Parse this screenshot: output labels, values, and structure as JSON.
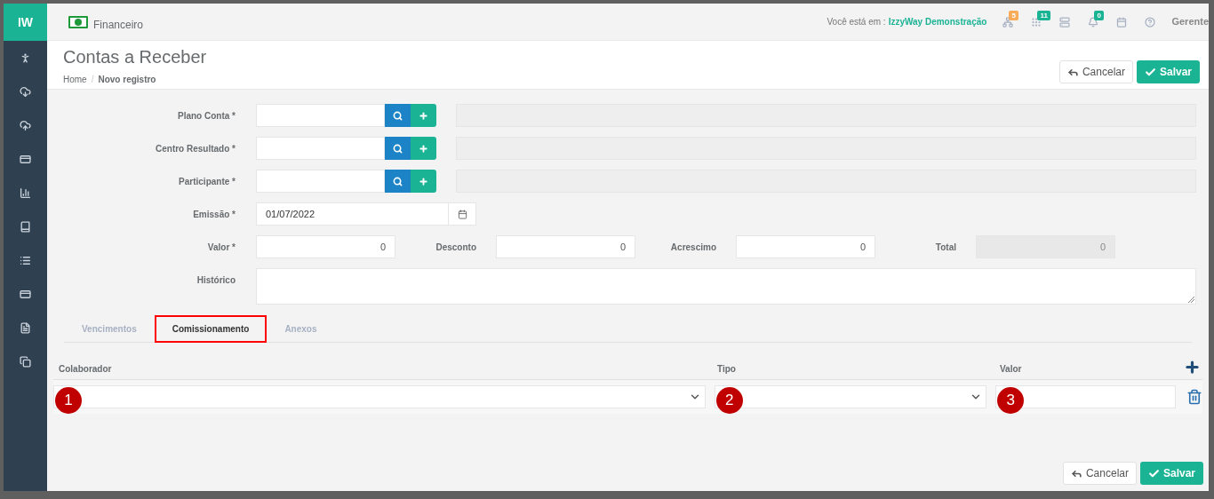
{
  "sidebar": {
    "logo": "IW",
    "items": [
      {
        "kind": "person"
      },
      {
        "kind": "download"
      },
      {
        "kind": "upload"
      },
      {
        "kind": "card"
      },
      {
        "kind": "chart"
      },
      {
        "kind": "book"
      },
      {
        "kind": "list"
      },
      {
        "kind": "card"
      },
      {
        "kind": "file"
      },
      {
        "kind": "copy"
      }
    ]
  },
  "header": {
    "module": "Financeiro",
    "location_label": "Você está em :",
    "location": "IzzyWay Demonstração",
    "icons": [
      {
        "kind": "sitemap",
        "badge": "5",
        "color": "#f8ac59"
      },
      {
        "kind": "grid",
        "badge": "11",
        "color": "#1ab394"
      },
      {
        "kind": "server"
      },
      {
        "kind": "bell",
        "badge": "0",
        "color": "#1ab394"
      },
      {
        "kind": "calendar"
      },
      {
        "kind": "help"
      }
    ],
    "user": "Gerente"
  },
  "page": {
    "title": "Contas a Receber",
    "breadcrumb": [
      "Home",
      "Novo registro"
    ],
    "separator": "/"
  },
  "top_actions": [
    {
      "kind": "cancel",
      "label": "Cancelar"
    },
    {
      "kind": "save",
      "label": "Salvar"
    }
  ],
  "form": [
    {
      "kind": "lookup",
      "label": "Plano Conta *"
    },
    {
      "kind": "lookup",
      "label": "Centro Resultado *"
    },
    {
      "kind": "lookup",
      "label": "Participante *"
    },
    {
      "kind": "date",
      "label": "Emissão *",
      "value": "01/07/2022"
    },
    {
      "kind": "amounts",
      "fields": [
        {
          "label": "Valor *",
          "value": "0",
          "readonly": false
        },
        {
          "label": "Desconto",
          "value": "0",
          "readonly": false
        },
        {
          "label": "Acrescimo",
          "value": "0",
          "readonly": false
        },
        {
          "label": "Total",
          "value": "0",
          "readonly": true
        }
      ]
    },
    {
      "kind": "textarea",
      "label": "Histórico"
    }
  ],
  "tabs": [
    {
      "label": "Vencimentos",
      "selected": false,
      "highlighted": false
    },
    {
      "label": "Comissionamento",
      "selected": true,
      "highlighted": true
    },
    {
      "label": "Anexos",
      "selected": false,
      "highlighted": false
    }
  ],
  "commission": {
    "columns": [
      "Colaborador",
      "Tipo",
      "Valor"
    ],
    "rows": [
      {
        "markers": [
          "1",
          "2",
          "3"
        ]
      }
    ]
  },
  "bottom_actions": [
    {
      "kind": "cancel",
      "label": "Cancelar"
    },
    {
      "kind": "save",
      "label": "Salvar"
    }
  ]
}
